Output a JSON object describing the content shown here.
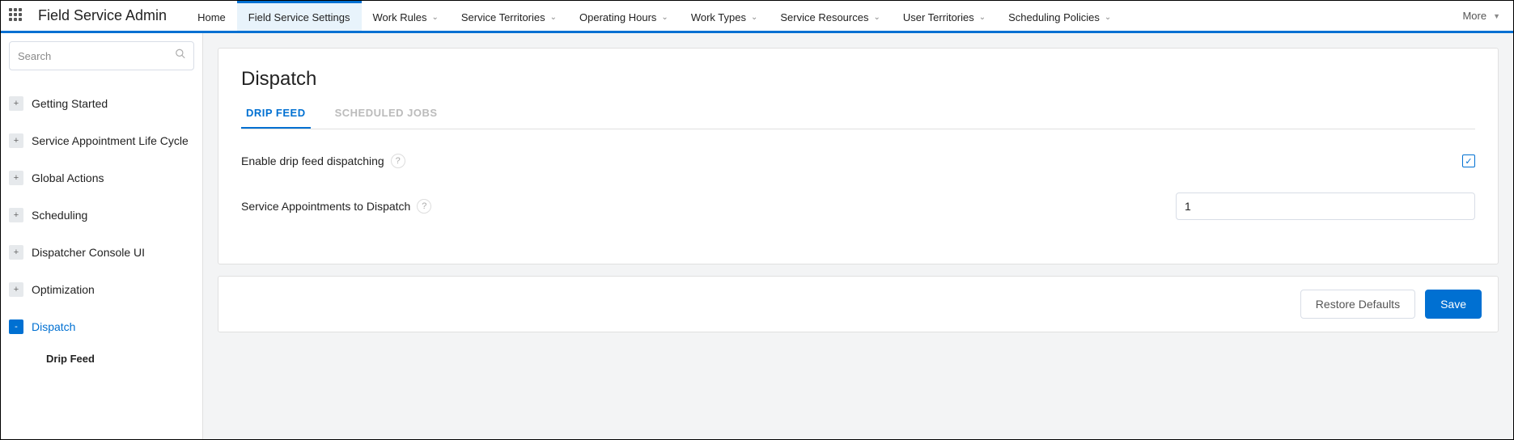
{
  "header": {
    "app_title": "Field Service Admin",
    "nav": [
      {
        "label": "Home",
        "dropdown": false,
        "active": false
      },
      {
        "label": "Field Service Settings",
        "dropdown": false,
        "active": true
      },
      {
        "label": "Work Rules",
        "dropdown": true,
        "active": false
      },
      {
        "label": "Service Territories",
        "dropdown": true,
        "active": false
      },
      {
        "label": "Operating Hours",
        "dropdown": true,
        "active": false
      },
      {
        "label": "Work Types",
        "dropdown": true,
        "active": false
      },
      {
        "label": "Service Resources",
        "dropdown": true,
        "active": false
      },
      {
        "label": "User Territories",
        "dropdown": true,
        "active": false
      },
      {
        "label": "Scheduling Policies",
        "dropdown": true,
        "active": false
      }
    ],
    "more_label": "More"
  },
  "sidebar": {
    "search_placeholder": "Search",
    "items": [
      {
        "label": "Getting Started",
        "expanded": false,
        "active": false
      },
      {
        "label": "Service Appointment Life Cycle",
        "expanded": false,
        "active": false
      },
      {
        "label": "Global Actions",
        "expanded": false,
        "active": false
      },
      {
        "label": "Scheduling",
        "expanded": false,
        "active": false
      },
      {
        "label": "Dispatcher Console UI",
        "expanded": false,
        "active": false
      },
      {
        "label": "Optimization",
        "expanded": false,
        "active": false
      },
      {
        "label": "Dispatch",
        "expanded": true,
        "active": true
      }
    ],
    "sub_item": "Drip Feed"
  },
  "main": {
    "title": "Dispatch",
    "tabs": [
      {
        "label": "DRIP FEED",
        "active": true
      },
      {
        "label": "SCHEDULED JOBS",
        "active": false
      }
    ],
    "setting1_label": "Enable drip feed dispatching",
    "setting2_label": "Service Appointments to Dispatch",
    "setting2_value": "1",
    "restore_label": "Restore Defaults",
    "save_label": "Save"
  }
}
